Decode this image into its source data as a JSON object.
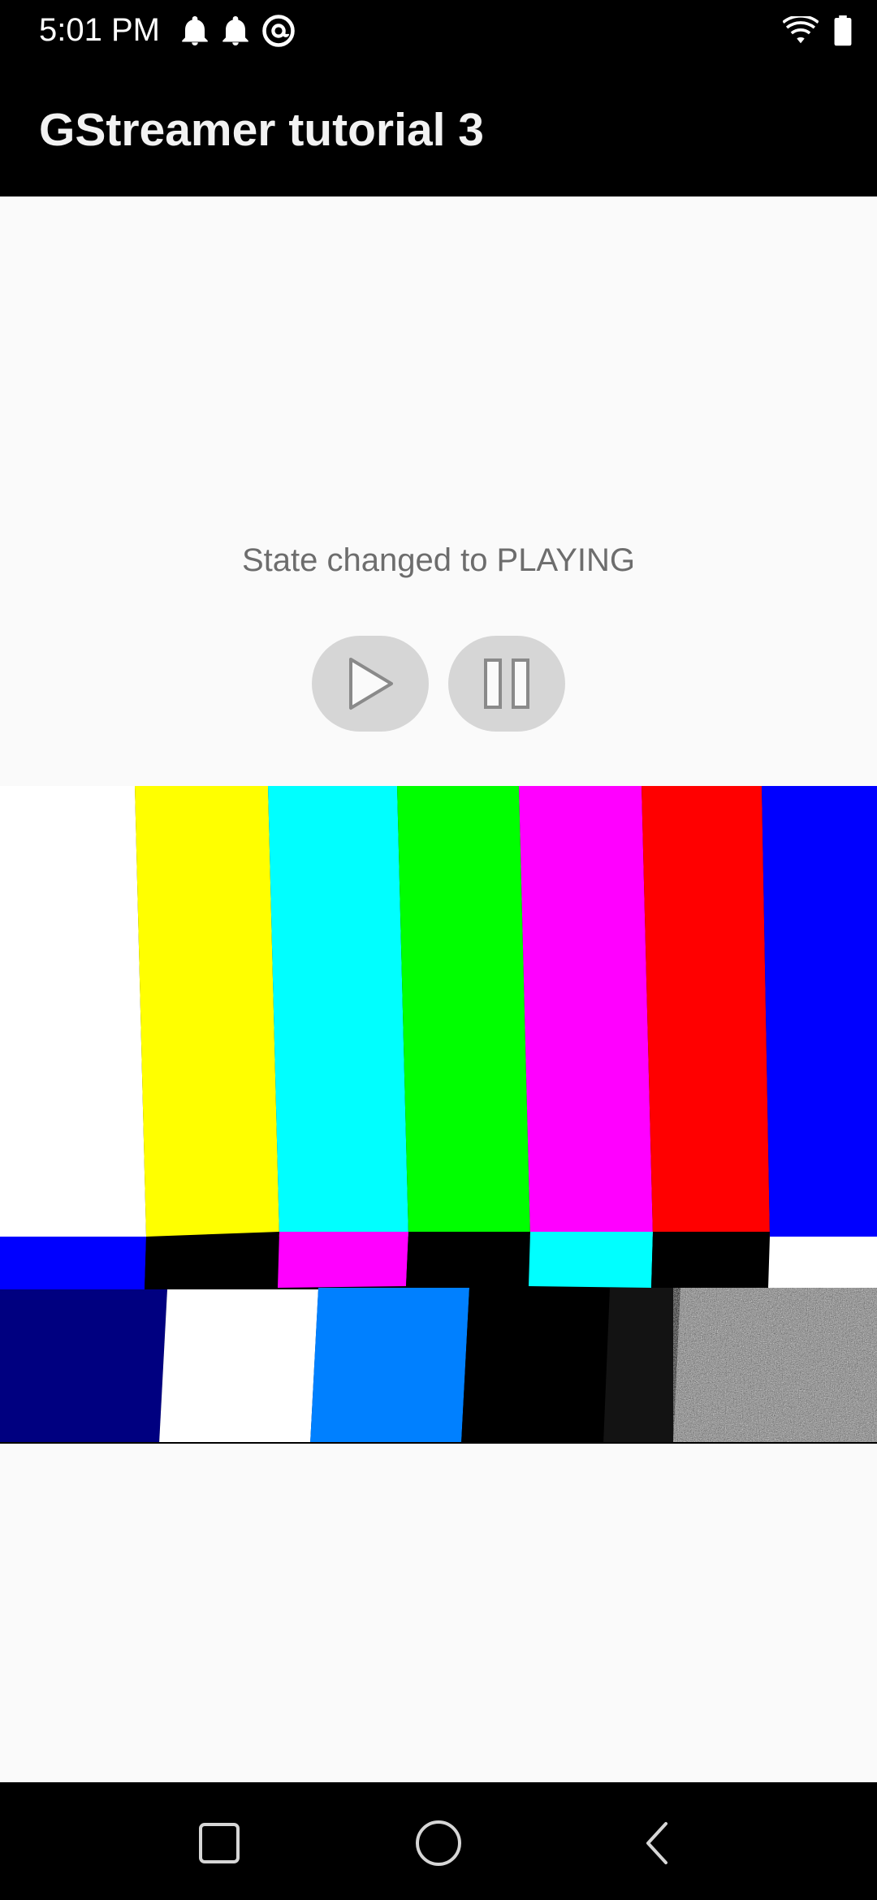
{
  "status_bar": {
    "time": "5:01 PM",
    "left_icons": [
      "notification-bell-icon",
      "notification-bell-icon",
      "at-sign-icon"
    ],
    "right_icons": [
      "wifi-icon",
      "battery-icon"
    ]
  },
  "app_bar": {
    "title": "GStreamer tutorial 3",
    "background": "#000000"
  },
  "main": {
    "state_message": "State changed to PLAYING",
    "play_button_icon": "play-icon",
    "pause_button_icon": "pause-icon",
    "video_surface": {
      "content": "SMPTE color bars test pattern with noise",
      "top_bar_colors": [
        "#ffffff",
        "#ffff00",
        "#00ffff",
        "#00ff00",
        "#ff00ff",
        "#ff0000",
        "#0000ff"
      ],
      "middle_bar_colors": [
        "#0000ff",
        "#000000",
        "#ff00ff",
        "#000000",
        "#00ffff",
        "#000000",
        "#ffffff"
      ],
      "bottom_block_colors": [
        "#000080",
        "#ffffff",
        "#0080ff",
        "#000000",
        "#131313",
        "noise"
      ]
    }
  },
  "nav_bar": {
    "recents_icon": "square-recents-icon",
    "home_icon": "circle-home-icon",
    "back_icon": "triangle-back-icon"
  }
}
